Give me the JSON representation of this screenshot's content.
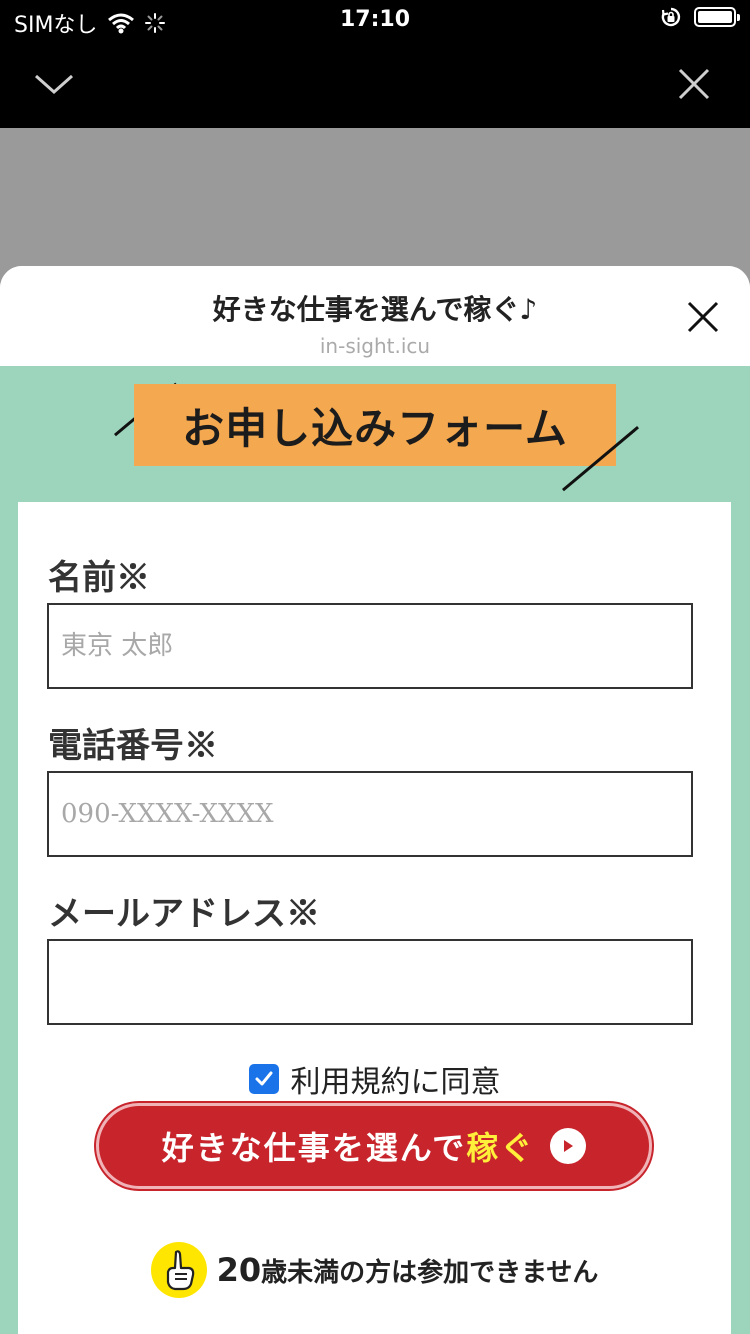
{
  "status_bar": {
    "carrier": "SIMなし",
    "time": "17:10",
    "icons": [
      "wifi-icon",
      "loading-spinner-icon",
      "orientation-lock-icon",
      "battery-icon"
    ],
    "battery_level": 1.0
  },
  "top_bar": {
    "icons": [
      "chevron-down-icon",
      "close-icon"
    ]
  },
  "sheet": {
    "title": "好きな仕事を選んで稼ぐ♪",
    "host": "in-sight.icu",
    "close_icon": "close-icon"
  },
  "form": {
    "banner_title": "お申し込みフォーム",
    "fields": [
      {
        "label": "名前※",
        "value": "",
        "placeholder": "東京 太郎"
      },
      {
        "label": "電話番号※",
        "value": "",
        "placeholder": "090-XXXX-XXXX"
      },
      {
        "label": "メールアドレス※",
        "value": "",
        "placeholder": ""
      }
    ],
    "agree": {
      "label": "利用規約に同意",
      "checked": true
    },
    "submit": {
      "text_main": "好きな仕事を選んで",
      "text_highlight": "稼ぐ",
      "icon": "play-circle-icon"
    },
    "notice": {
      "age": "20",
      "text": "歳未満の方は参加できません",
      "icon": "pointing-hand-icon"
    }
  },
  "colors": {
    "form_background": "#9cd5bb",
    "banner": "#f4a84f",
    "button": "#c8242c",
    "button_highlight": "#ffee3a",
    "checkbox": "#1a73e8",
    "notice_icon": "#ffe600"
  }
}
